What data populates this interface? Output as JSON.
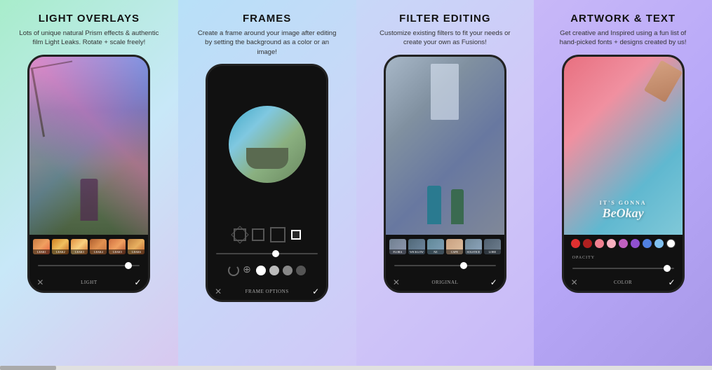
{
  "cards": [
    {
      "id": "card-1",
      "title": "LIGHT OVERLAYS",
      "description": "Lots of unique natural Prism effects & authentic film Light Leaks. Rotate + scale freely!",
      "bottom_label": "LIGHT",
      "slider_position": "85%",
      "filters": [
        {
          "label": "LEAK1",
          "class": "thumb-leak1"
        },
        {
          "label": "LEAK2",
          "class": "thumb-leak2"
        },
        {
          "label": "LEAK3",
          "class": "thumb-leak3"
        },
        {
          "label": "LEAK4",
          "class": "thumb-leak4"
        },
        {
          "label": "LEAK5",
          "class": "thumb-leak5"
        },
        {
          "label": "LEAK6",
          "class": "thumb-leak6"
        }
      ]
    },
    {
      "id": "card-2",
      "title": "FRAMES",
      "description": "Create a frame around your image after editing by setting the background as a color or an image!",
      "bottom_label": "FRAME OPTIONS",
      "slider_position": "55%"
    },
    {
      "id": "card-3",
      "title": "FILTER EDITING",
      "description": "Customize existing filters to fit your needs or create your own as Fusions!",
      "bottom_label": "ORIGINAL",
      "slider_position": "65%",
      "filters": [
        {
          "label": "FLORA",
          "class": "thumb-flora"
        },
        {
          "label": "WICKLOW",
          "class": "thumb-wicklow"
        },
        {
          "label": "NZ",
          "class": "thumb-nz"
        },
        {
          "label": "CAPE",
          "class": "thumb-cape"
        },
        {
          "label": "SOLSTICE",
          "class": "thumb-solstice"
        },
        {
          "label": "LORE",
          "class": "thumb-lore"
        }
      ]
    },
    {
      "id": "card-4",
      "title": "ARTWORK & TEXT",
      "description": "Get creative and Inspired using a fun list of hand-picked fonts + designs created by us!",
      "bottom_label": "COLOR",
      "slider_position": "90%",
      "opacity_label": "OPACITY",
      "artwork_text_small": "IT'S GONNA",
      "artwork_text_large": "BeOkay"
    }
  ],
  "scrollbar": {
    "position": "left"
  }
}
